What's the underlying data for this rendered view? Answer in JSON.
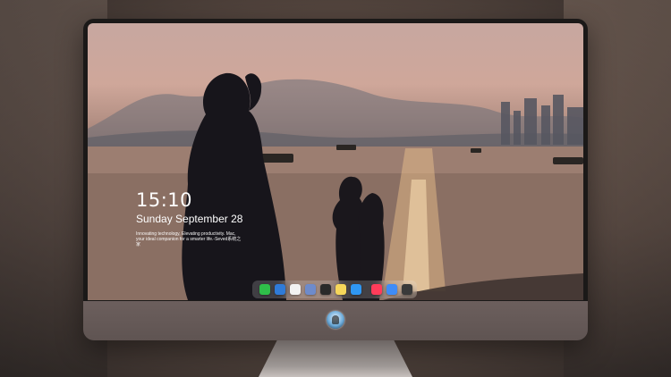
{
  "lock_screen": {
    "time": "15:10",
    "date": "Sunday September 28",
    "slogan": "Innovating technology, Elevating productivity. Mac, your ideal companion for a smarter life.-Seved系统之家"
  },
  "dock": {
    "items": [
      {
        "name": "messages-icon",
        "color": "#2fbf4a"
      },
      {
        "name": "finder-icon",
        "color": "#2f7bd8"
      },
      {
        "name": "safari-icon",
        "color": "#f2f2f2"
      },
      {
        "name": "preview-icon",
        "color": "#6e8bcb"
      },
      {
        "name": "movies-icon",
        "color": "#2a2a2a"
      },
      {
        "name": "notes-icon",
        "color": "#f6d65a"
      },
      {
        "name": "app-store-icon",
        "color": "#2f97f3"
      },
      {
        "name": "music-icon",
        "color": "#ff3c5a"
      },
      {
        "name": "folder-icon",
        "color": "#3f8cf7"
      },
      {
        "name": "camera-icon",
        "color": "#3a3a3a"
      }
    ]
  }
}
